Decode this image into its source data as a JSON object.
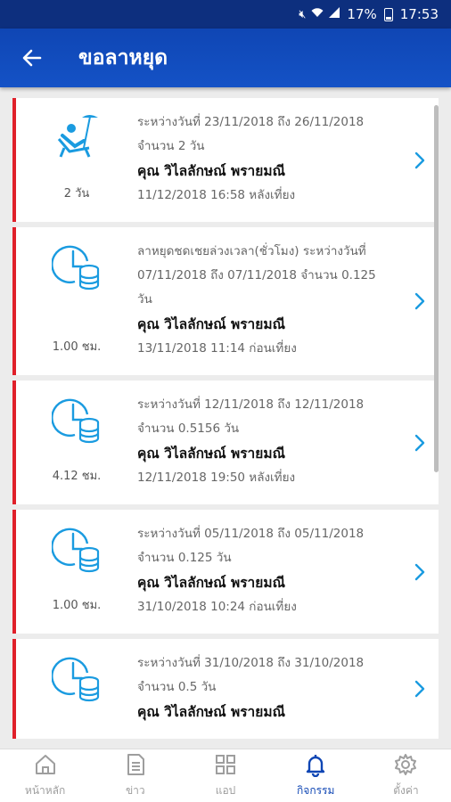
{
  "status_bar": {
    "battery": "17%",
    "time": "17:53"
  },
  "header": {
    "title": "ขอลาหยุด"
  },
  "requests": [
    {
      "icon": "beach-chair-icon",
      "lines": [
        "ระหว่างวันที่ 23/11/2018 ถึง 26/11/2018",
        "จำนวน 2 วัน"
      ],
      "name": "คุณ วิไลลักษณ์ พรายมณี",
      "date": "11/12/2018 16:58 หลังเที่ยง",
      "amount": "2 วัน"
    },
    {
      "icon": "clock-coins-icon",
      "lines": [
        "ลาหยุดชดเชยล่วงเวลา(ชั่วโมง) ระหว่างวันที่",
        "07/11/2018 ถึง 07/11/2018 จำนวน 0.125",
        "วัน"
      ],
      "name": "คุณ วิไลลักษณ์ พรายมณี",
      "date": "13/11/2018 11:14 ก่อนเที่ยง",
      "amount": "1.00 ชม."
    },
    {
      "icon": "clock-coins-icon",
      "lines": [
        "ระหว่างวันที่ 12/11/2018 ถึง 12/11/2018",
        "จำนวน 0.5156 วัน"
      ],
      "name": "คุณ วิไลลักษณ์ พรายมณี",
      "date": "12/11/2018 19:50 หลังเที่ยง",
      "amount": "4.12 ชม."
    },
    {
      "icon": "clock-coins-icon",
      "lines": [
        "ระหว่างวันที่ 05/11/2018 ถึง 05/11/2018",
        "จำนวน 0.125 วัน"
      ],
      "name": "คุณ วิไลลักษณ์ พรายมณี",
      "date": "31/10/2018 10:24 ก่อนเที่ยง",
      "amount": "1.00 ชม."
    },
    {
      "icon": "clock-coins-icon",
      "lines": [
        "ระหว่างวันที่ 31/10/2018 ถึง 31/10/2018",
        "จำนวน 0.5 วัน"
      ],
      "name": "คุณ วิไลลักษณ์ พรายมณี",
      "date": "",
      "amount": ""
    }
  ],
  "bottom_nav": [
    {
      "label": "หน้าหลัก",
      "icon": "home-icon",
      "active": false
    },
    {
      "label": "ข่าว",
      "icon": "news-icon",
      "active": false
    },
    {
      "label": "แอป",
      "icon": "apps-grid-icon",
      "active": false
    },
    {
      "label": "กิจกรรม",
      "icon": "bell-icon",
      "active": true
    },
    {
      "label": "ตั้งค่า",
      "icon": "gear-icon",
      "active": false
    }
  ],
  "colors": {
    "app_bar": "#0f46b4",
    "status_bar": "#0d2f7e",
    "accent_line": "#e0202a",
    "icon_blue": "#1a9be0"
  }
}
